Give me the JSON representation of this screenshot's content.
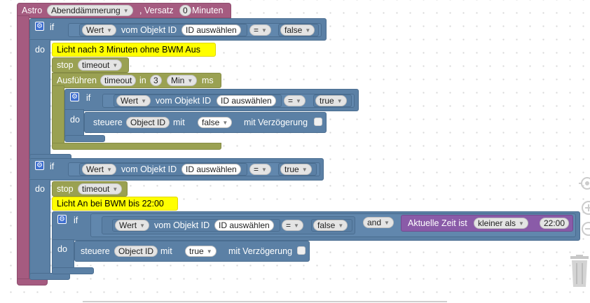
{
  "trigger": {
    "label": "Astro",
    "event": "Abenddämmerung",
    "offset_label": ", Versatz",
    "offset_value": "0",
    "unit": "Minuten"
  },
  "if1": {
    "if_label": "if",
    "do_label": "do",
    "cond_field": "Wert",
    "cond_text": "vom Objekt ID",
    "cond_id": "ID auswählen",
    "cond_op": "=",
    "cond_value": "false"
  },
  "comment1": "Licht nach 3 Minuten ohne BWM Aus",
  "stop1": {
    "label": "stop",
    "name": "timeout"
  },
  "execute": {
    "label": "Ausführen",
    "name": "timeout",
    "in_label": "in",
    "value": "3",
    "unit": "Min",
    "ms_label": "ms"
  },
  "if2": {
    "if_label": "if",
    "do_label": "do",
    "cond_field": "Wert",
    "cond_text": "vom Objekt ID",
    "cond_id": "ID auswählen",
    "cond_op": "=",
    "cond_value": "true"
  },
  "control1": {
    "label": "steuere",
    "object": "Object ID",
    "with_label": "mit",
    "value": "false",
    "delay_label": "mit Verzögerung"
  },
  "if3": {
    "if_label": "if",
    "do_label": "do",
    "cond_field": "Wert",
    "cond_text": "vom Objekt ID",
    "cond_id": "ID auswählen",
    "cond_op": "=",
    "cond_value": "true"
  },
  "stop2": {
    "label": "stop",
    "name": "timeout"
  },
  "comment2": "Licht An bei BWM bis 22:00",
  "if4": {
    "if_label": "if",
    "do_label": "do",
    "cond_field": "Wert",
    "cond_text": "vom Objekt ID",
    "cond_id": "ID auswählen",
    "cond_op": "=",
    "cond_value": "false",
    "logic_op": "and",
    "time_label": "Aktuelle Zeit ist",
    "time_compare": "kleiner als",
    "time_value": "22:00"
  },
  "control2": {
    "label": "steuere",
    "object": "Object ID",
    "with_label": "mit",
    "value": "true",
    "delay_label": "mit Verzögerung"
  },
  "dropdown_arrow": "▼",
  "gear_glyph": "⚙",
  "icons": [
    "gear-icon",
    "target-icon",
    "zoom-in-icon",
    "zoom-out-icon",
    "trash-icon"
  ],
  "colors": {
    "trigger": "#a55b80",
    "logic": "#5b80a5",
    "timeout": "#9aa152",
    "comment": "#ffff00",
    "time": "#8a5ba8"
  }
}
